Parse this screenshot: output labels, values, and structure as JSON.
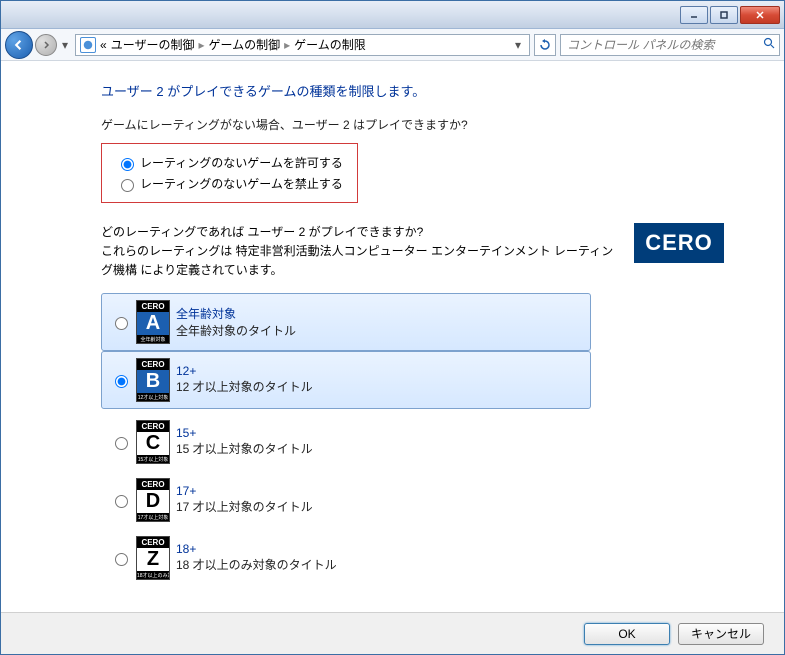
{
  "titlebar": {},
  "breadcrumb": {
    "prefix": "«",
    "path1": "ユーザーの制御",
    "path2": "ゲームの制御",
    "path3": "ゲームの制限"
  },
  "search": {
    "placeholder": "コントロール パネルの検索"
  },
  "heading": "ユーザー 2 がプレイできるゲームの種類を制限します。",
  "question1": "ゲームにレーティングがない場合、ユーザー 2 はプレイできますか?",
  "radio": {
    "allow": "レーティングのないゲームを許可する",
    "block": "レーティングのないゲームを禁止する"
  },
  "question2_line1": "どのレーティングであれば ユーザー 2 がプレイできますか?",
  "question2_line2": "これらのレーティングは 特定非営利活動法人コンピューター エンターテインメント レーティング機構 により定義されています。",
  "cero_logo": "CERO",
  "ratings": [
    {
      "letter": "A",
      "badge_bottom": "全年齢対象",
      "title": "全年齢対象",
      "desc": "全年齢対象のタイトル",
      "selected": false,
      "highlighted": true
    },
    {
      "letter": "B",
      "badge_bottom": "12才以上対象",
      "title": "12+",
      "desc": "12 才以上対象のタイトル",
      "selected": true,
      "highlighted": true
    },
    {
      "letter": "C",
      "badge_bottom": "15才以上対象",
      "title": "15+",
      "desc": "15 才以上対象のタイトル",
      "selected": false,
      "highlighted": false
    },
    {
      "letter": "D",
      "badge_bottom": "17才以上対象",
      "title": "17+",
      "desc": "17 才以上対象のタイトル",
      "selected": false,
      "highlighted": false
    },
    {
      "letter": "Z",
      "badge_bottom": "18才以上のみ対象",
      "title": "18+",
      "desc": "18 才以上のみ対象のタイトル",
      "selected": false,
      "highlighted": false
    }
  ],
  "footer": {
    "ok": "OK",
    "cancel": "キャンセル"
  }
}
